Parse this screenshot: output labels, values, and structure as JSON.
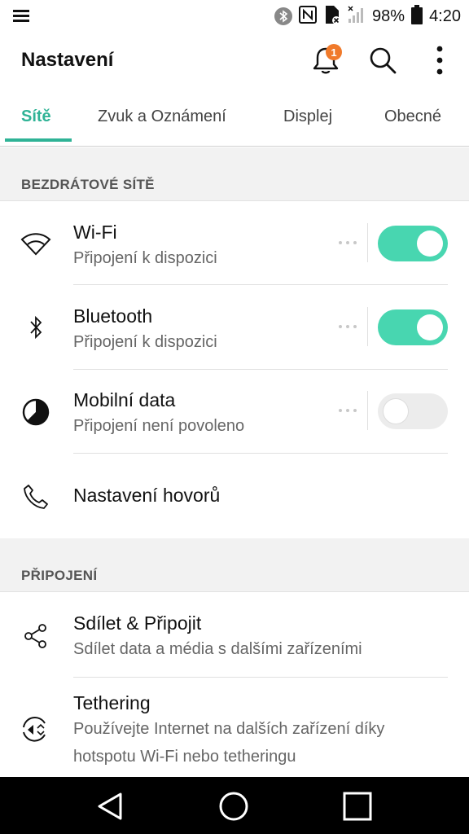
{
  "status_bar": {
    "battery_percent": "98%",
    "time": "4:20",
    "icons": [
      "menu-icon",
      "bluetooth-icon",
      "nfc-icon",
      "sim-icon",
      "signal-icon",
      "battery-icon"
    ]
  },
  "app_bar": {
    "title": "Nastavení",
    "notification_count": "1",
    "icons": [
      "bell-icon",
      "search-icon",
      "more-vert-icon"
    ]
  },
  "tabs": [
    {
      "label": "Sítě",
      "active": true
    },
    {
      "label": "Zvuk a Oznámení",
      "active": false
    },
    {
      "label": "Displej",
      "active": false
    },
    {
      "label": "Obecné",
      "active": false
    }
  ],
  "sections": [
    {
      "header": "BEZDRÁTOVÉ SÍTĚ",
      "items": [
        {
          "title": "Wi-Fi",
          "subtitle": "Připojení k dispozici",
          "icon": "wifi-icon",
          "toggle": "on"
        },
        {
          "title": "Bluetooth",
          "subtitle": "Připojení k dispozici",
          "icon": "bluetooth-icon",
          "toggle": "on"
        },
        {
          "title": "Mobilní data",
          "subtitle": "Připojení není povoleno",
          "icon": "mobile-data-icon",
          "toggle": "off"
        },
        {
          "title": "Nastavení hovorů",
          "icon": "phone-icon"
        }
      ]
    },
    {
      "header": "PŘIPOJENÍ",
      "items": [
        {
          "title": "Sdílet & Připojit",
          "subtitle": "Sdílet data a média s dalšími zařízeními",
          "icon": "share-icon"
        },
        {
          "title": "Tethering",
          "subtitle_line1": "Používejte Internet na dalších zařízení díky",
          "subtitle_line2": "hotspotu Wi-Fi nebo tetheringu",
          "icon": "tethering-icon"
        }
      ]
    }
  ],
  "nav_bar": {
    "icons": [
      "back-icon",
      "home-icon",
      "recents-icon"
    ]
  },
  "colors": {
    "accent": "#2fb396",
    "toggle_on": "#48d6b0",
    "badge": "#f07a2b"
  }
}
